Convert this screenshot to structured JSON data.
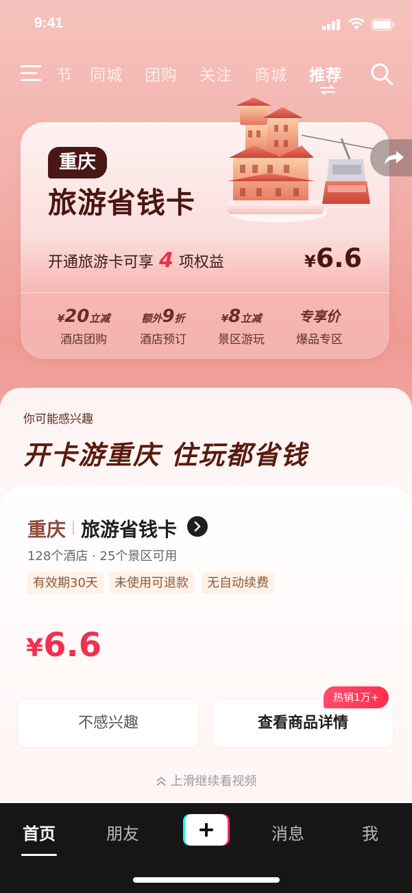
{
  "status_bar": {
    "time": "9:41"
  },
  "top_nav": {
    "tabs": [
      {
        "label": "节"
      },
      {
        "label": "同城"
      },
      {
        "label": "团购"
      },
      {
        "label": "关注"
      },
      {
        "label": "商城"
      },
      {
        "label": "推荐"
      }
    ],
    "active_tab": "推荐"
  },
  "card": {
    "city": "重庆",
    "title": "旅游省钱卡",
    "benefit_prefix": "开通旅游卡可享",
    "benefit_count": "4",
    "benefit_suffix": "项权益",
    "price_symbol": "¥",
    "price_value": "6.6",
    "perks": [
      {
        "pre": "¥",
        "big": "20",
        "post": "立减",
        "label": "酒店团购"
      },
      {
        "pre": "额外",
        "big": "9",
        "post": "折",
        "label": "酒店预订"
      },
      {
        "pre": "¥",
        "big": "8",
        "post": "立减",
        "label": "景区游玩"
      },
      {
        "pre": "",
        "big": "",
        "post": "专享价",
        "label": "爆品专区"
      }
    ]
  },
  "panel": {
    "hint": "你可能感兴趣",
    "headline": "开卡游重庆 住玩都省钱",
    "product": {
      "city": "重庆",
      "title": "旅游省钱卡",
      "subtitle": "128个酒店 · 25个景区可用",
      "tags": [
        "有效期30天",
        "未使用可退款",
        "无自动续费"
      ],
      "price_symbol": "¥",
      "price_value": "6.6"
    },
    "buttons": {
      "not_interested": "不感兴趣",
      "view_details": "查看商品详情",
      "hot_badge": "热销1万+"
    },
    "swipe_hint": "上滑继续看视频"
  },
  "bottom_nav": {
    "items": [
      {
        "label": "首页"
      },
      {
        "label": "朋友"
      },
      {
        "label": "消息"
      },
      {
        "label": "我"
      }
    ],
    "active": "首页"
  },
  "colors": {
    "accent_red": "#f0314f",
    "dark_brown": "#4a1512",
    "nav_bg": "#161616"
  }
}
